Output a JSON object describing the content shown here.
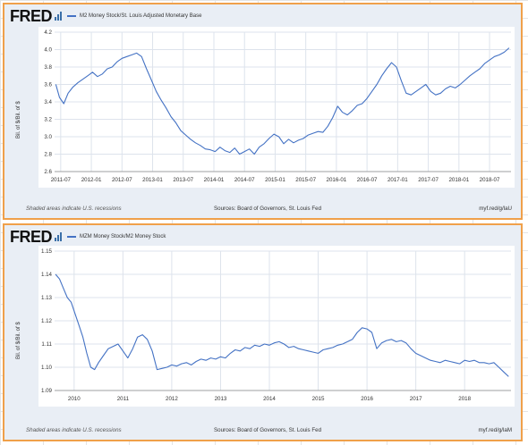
{
  "charts": [
    {
      "logo": "FRED",
      "title": "M2 Money Stock/St. Louis Adjusted Monetary Base",
      "ylabel": "Bil. of $/Bil. of $",
      "footer_note": "Shaded areas indicate U.S. recessions",
      "source": "Sources: Board of Governors, St. Louis Fed",
      "url": "myf.red/g/laU"
    },
    {
      "logo": "FRED",
      "title": "MZM Money Stock/M2 Money Stock",
      "ylabel": "Bil. of $/Bil. of $",
      "footer_note": "Shaded areas indicate U.S. recessions",
      "source": "Sources: Board of Governors, St. Louis Fed",
      "url": "myf.red/g/laM"
    }
  ],
  "colors": {
    "line": "#4472c4",
    "border": "#f0a04a",
    "panel": "#e9eef5"
  },
  "chart_data": [
    {
      "type": "line",
      "title": "M2 Money Stock/St. Louis Adjusted Monetary Base",
      "ylabel": "Bil. of $/Bil. of $",
      "xlabel": "",
      "ylim": [
        2.6,
        4.2
      ],
      "yticks": [
        "2.6",
        "2.8",
        "3.0",
        "3.2",
        "3.4",
        "3.6",
        "3.8",
        "4.0",
        "4.2"
      ],
      "xticks": [
        [
          2011.5,
          "2011-07"
        ],
        [
          2012.0,
          "2012-01"
        ],
        [
          2012.5,
          "2012-07"
        ],
        [
          2013.0,
          "2013-01"
        ],
        [
          2013.5,
          "2013-07"
        ],
        [
          2014.0,
          "2014-01"
        ],
        [
          2014.5,
          "2014-07"
        ],
        [
          2015.0,
          "2015-01"
        ],
        [
          2015.5,
          "2015-07"
        ],
        [
          2016.0,
          "2016-01"
        ],
        [
          2016.5,
          "2016-07"
        ],
        [
          2017.0,
          "2017-01"
        ],
        [
          2017.5,
          "2017-07"
        ],
        [
          2018.0,
          "2018-01"
        ],
        [
          2018.5,
          "2018-07"
        ]
      ],
      "xlim": [
        2011.4,
        2018.85
      ],
      "grid": true,
      "series": [
        {
          "x": [
            2011.42,
            2011.48,
            2011.55,
            2011.62,
            2011.7,
            2011.78,
            2011.86,
            2011.94,
            2012.02,
            2012.1,
            2012.18,
            2012.26,
            2012.34,
            2012.42,
            2012.5,
            2012.58,
            2012.66,
            2012.74,
            2012.82,
            2012.9,
            2012.98,
            2013.06,
            2013.14,
            2013.22,
            2013.3,
            2013.38,
            2013.46,
            2013.54,
            2013.62,
            2013.7,
            2013.78,
            2013.86,
            2013.94,
            2014.02,
            2014.1,
            2014.18,
            2014.26,
            2014.34,
            2014.42,
            2014.5,
            2014.58,
            2014.66,
            2014.74,
            2014.82,
            2014.9,
            2014.98,
            2015.06,
            2015.14,
            2015.22,
            2015.3,
            2015.38,
            2015.46,
            2015.54,
            2015.62,
            2015.7,
            2015.78,
            2015.86,
            2015.94,
            2016.02,
            2016.1,
            2016.18,
            2016.26,
            2016.34,
            2016.42,
            2016.5,
            2016.58,
            2016.66,
            2016.74,
            2016.82,
            2016.9,
            2016.98,
            2017.06,
            2017.14,
            2017.22,
            2017.3,
            2017.38,
            2017.46,
            2017.54,
            2017.62,
            2017.7,
            2017.78,
            2017.86,
            2017.94,
            2018.02,
            2018.1,
            2018.18,
            2018.26,
            2018.34,
            2018.42,
            2018.5,
            2018.58,
            2018.66,
            2018.74,
            2018.82
          ],
          "y": [
            3.6,
            3.45,
            3.38,
            3.5,
            3.57,
            3.62,
            3.66,
            3.7,
            3.74,
            3.69,
            3.72,
            3.78,
            3.8,
            3.86,
            3.9,
            3.92,
            3.94,
            3.96,
            3.92,
            3.78,
            3.65,
            3.52,
            3.42,
            3.33,
            3.23,
            3.16,
            3.07,
            3.02,
            2.97,
            2.93,
            2.9,
            2.86,
            2.85,
            2.83,
            2.88,
            2.84,
            2.82,
            2.87,
            2.8,
            2.83,
            2.86,
            2.8,
            2.88,
            2.92,
            2.98,
            3.03,
            3.0,
            2.92,
            2.97,
            2.93,
            2.96,
            2.98,
            3.02,
            3.04,
            3.06,
            3.05,
            3.12,
            3.22,
            3.35,
            3.28,
            3.25,
            3.3,
            3.36,
            3.38,
            3.44,
            3.52,
            3.6,
            3.7,
            3.78,
            3.85,
            3.8,
            3.64,
            3.5,
            3.48,
            3.52,
            3.56,
            3.6,
            3.52,
            3.48,
            3.5,
            3.55,
            3.58,
            3.56,
            3.6,
            3.65,
            3.7,
            3.74,
            3.78,
            3.84,
            3.88,
            3.92,
            3.94,
            3.97,
            4.02
          ]
        }
      ]
    },
    {
      "type": "line",
      "title": "MZM Money Stock/M2 Money Stock",
      "ylabel": "Bil. of $/Bil. of $",
      "xlabel": "",
      "ylim": [
        1.09,
        1.15
      ],
      "yticks": [
        "1.09",
        "1.10",
        "1.11",
        "1.12",
        "1.13",
        "1.14",
        "1.15"
      ],
      "xticks": [
        [
          2010,
          "2010"
        ],
        [
          2011,
          "2011"
        ],
        [
          2012,
          "2012"
        ],
        [
          2013,
          "2013"
        ],
        [
          2014,
          "2014"
        ],
        [
          2015,
          "2015"
        ],
        [
          2016,
          "2016"
        ],
        [
          2017,
          "2017"
        ],
        [
          2018,
          "2018"
        ]
      ],
      "xlim": [
        2009.6,
        2018.95
      ],
      "grid": true,
      "series": [
        {
          "x": [
            2009.62,
            2009.7,
            2009.78,
            2009.86,
            2009.94,
            2010.02,
            2010.1,
            2010.18,
            2010.26,
            2010.34,
            2010.42,
            2010.5,
            2010.6,
            2010.7,
            2010.8,
            2010.9,
            2011.0,
            2011.1,
            2011.2,
            2011.3,
            2011.4,
            2011.5,
            2011.6,
            2011.7,
            2011.8,
            2011.9,
            2012.0,
            2012.1,
            2012.2,
            2012.3,
            2012.4,
            2012.5,
            2012.6,
            2012.7,
            2012.8,
            2012.9,
            2013.0,
            2013.1,
            2013.2,
            2013.3,
            2013.4,
            2013.5,
            2013.6,
            2013.7,
            2013.8,
            2013.9,
            2014.0,
            2014.1,
            2014.2,
            2014.3,
            2014.4,
            2014.5,
            2014.6,
            2014.7,
            2014.8,
            2014.9,
            2015.0,
            2015.1,
            2015.2,
            2015.3,
            2015.4,
            2015.5,
            2015.6,
            2015.7,
            2015.8,
            2015.9,
            2016.0,
            2016.1,
            2016.2,
            2016.3,
            2016.4,
            2016.5,
            2016.6,
            2016.7,
            2016.8,
            2016.9,
            2017.0,
            2017.1,
            2017.2,
            2017.3,
            2017.4,
            2017.5,
            2017.6,
            2017.7,
            2017.8,
            2017.9,
            2018.0,
            2018.1,
            2018.2,
            2018.3,
            2018.4,
            2018.5,
            2018.6,
            2018.7,
            2018.8,
            2018.9
          ],
          "y": [
            1.14,
            1.138,
            1.134,
            1.13,
            1.128,
            1.123,
            1.118,
            1.113,
            1.106,
            1.1,
            1.099,
            1.102,
            1.105,
            1.108,
            1.109,
            1.11,
            1.107,
            1.104,
            1.108,
            1.113,
            1.114,
            1.112,
            1.107,
            1.099,
            1.0995,
            1.1,
            1.101,
            1.1005,
            1.1015,
            1.102,
            1.101,
            1.1025,
            1.1035,
            1.103,
            1.104,
            1.1035,
            1.1045,
            1.104,
            1.106,
            1.1075,
            1.107,
            1.1085,
            1.108,
            1.1095,
            1.109,
            1.11,
            1.1095,
            1.1105,
            1.111,
            1.11,
            1.1085,
            1.109,
            1.108,
            1.1075,
            1.107,
            1.1065,
            1.106,
            1.1075,
            1.108,
            1.1085,
            1.1095,
            1.11,
            1.111,
            1.112,
            1.115,
            1.117,
            1.1165,
            1.115,
            1.108,
            1.1105,
            1.1115,
            1.112,
            1.111,
            1.1115,
            1.1105,
            1.108,
            1.106,
            1.105,
            1.104,
            1.103,
            1.1025,
            1.102,
            1.103,
            1.1025,
            1.102,
            1.1015,
            1.103,
            1.1025,
            1.103,
            1.102,
            1.102,
            1.1015,
            1.102,
            1.1,
            1.098,
            1.096
          ]
        }
      ]
    }
  ]
}
